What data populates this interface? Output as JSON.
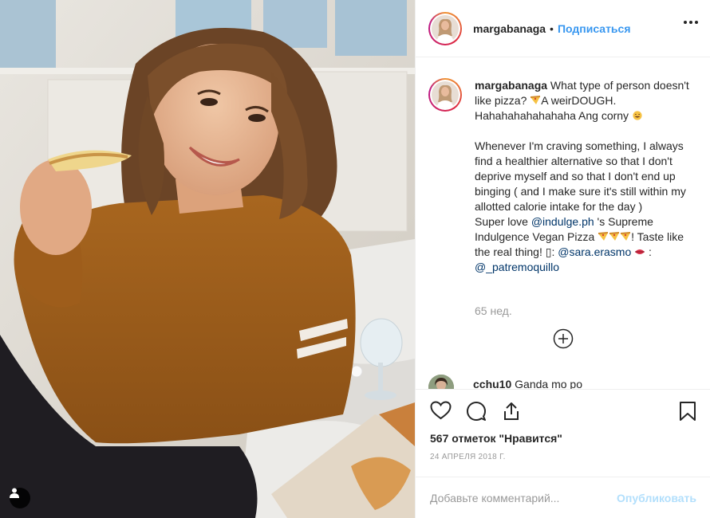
{
  "post": {
    "username": "margabanaga",
    "separator": "•",
    "follow_label": "Подписаться",
    "more_icon": "more-horizontal-icon"
  },
  "caption": {
    "username": "margabanaga",
    "line1": " What type of person doesn't like pizza? ",
    "line2": "A weirDOUGH. Hahahahahahahaha Ang corny ",
    "paragraph": "Whenever I'm craving something, I always find a healthier alternative so that I don't deprive myself and so that I don't end up binging ( and I make sure it's still within my allotted calorie intake for the day )",
    "line3_pre": "Super love ",
    "mention1": "@indulge.ph",
    "line3_post": " 's Supreme Indulgence Vegan Pizza ",
    "line4": "! Taste like the real thing! ",
    "camera_box": "▯",
    "line4_sep": ": ",
    "mention2": "@sara.erasmo",
    "line5_sep": " : ",
    "mention3": "@_patremoquillo"
  },
  "post_age": "65 нед.",
  "comment": {
    "username": "cchu10",
    "text": " Ganda mo po"
  },
  "actions": {
    "like_icon": "heart-icon",
    "comment_icon": "comment-icon",
    "share_icon": "share-icon",
    "save_icon": "bookmark-icon"
  },
  "likes_text": "567 отметок \"Нравится\"",
  "date_text": "24 АПРЕЛЯ 2018 Г.",
  "add_comment": {
    "placeholder": "Добавьте комментарий...",
    "publish_label": "Опубликовать"
  },
  "colors": {
    "link_blue": "#3897f0",
    "mention": "#003569",
    "publish_disabled": "#b2dffc",
    "muted": "#999999",
    "sweater": "#9a5c1f"
  }
}
